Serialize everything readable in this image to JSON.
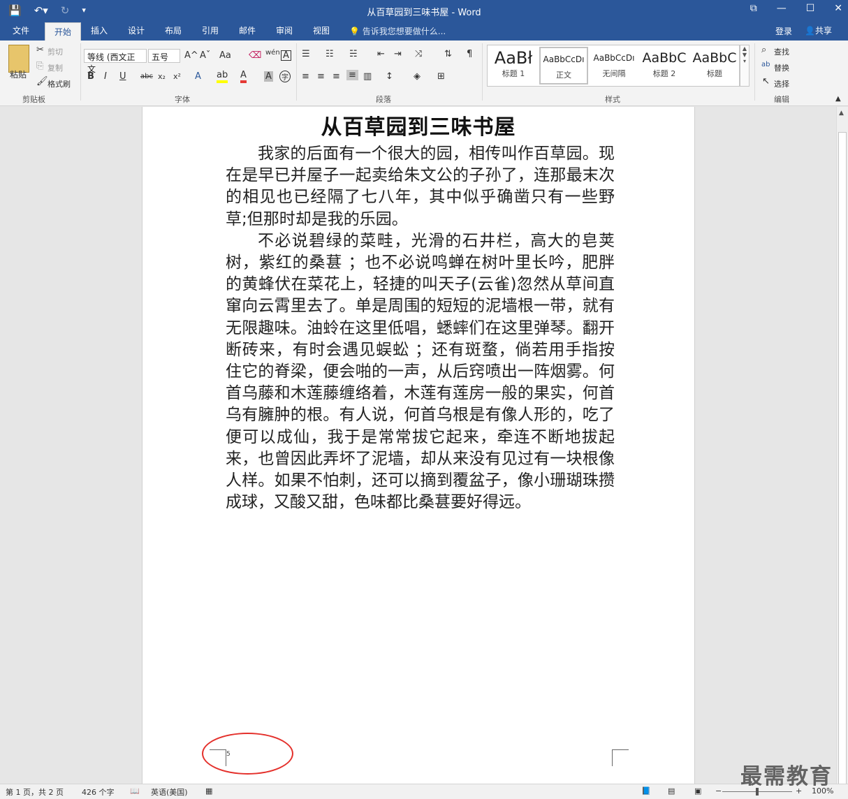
{
  "app": {
    "window_title": "从百草园到三味书屋 - Word"
  },
  "tabs": [
    {
      "label": "文件"
    },
    {
      "label": "开始"
    },
    {
      "label": "插入"
    },
    {
      "label": "设计"
    },
    {
      "label": "布局"
    },
    {
      "label": "引用"
    },
    {
      "label": "邮件"
    },
    {
      "label": "审阅"
    },
    {
      "label": "视图"
    }
  ],
  "tell_me": "告诉我您想要做什么...",
  "account": {
    "login": "登录",
    "share": "共享"
  },
  "clipboard": {
    "paste": "粘贴",
    "cut": "剪切",
    "copy": "复制",
    "format_painter": "格式刷",
    "group": "剪贴板"
  },
  "font": {
    "name": "等线 (西文正文",
    "size": "五号",
    "group": "字体",
    "bold": "B",
    "italic": "I",
    "underline": "U",
    "strike": "abc",
    "subscript": "x₂",
    "superscript": "x²",
    "grow": "A^",
    "shrink": "Aˇ",
    "change_case": "Aa",
    "phonetic": "wén",
    "border": "A",
    "effects": "A",
    "color": "A",
    "shading": "A",
    "enclose": "字"
  },
  "paragraph": {
    "group": "段落"
  },
  "styles": {
    "group": "样式",
    "items": [
      {
        "preview": "AaBł",
        "name": "标题 1"
      },
      {
        "preview": "AaBbCcDı",
        "name": "正文"
      },
      {
        "preview": "AaBbCcDı",
        "name": "无间隔"
      },
      {
        "preview": "AaBbC",
        "name": "标题 2"
      },
      {
        "preview": "AaBbC",
        "name": "标题"
      }
    ]
  },
  "editing": {
    "find": "查找",
    "replace": "替换",
    "select": "选择",
    "group": "编辑"
  },
  "document": {
    "title": "从百草园到三味书屋",
    "paragraphs": [
      "我家的后面有一个很大的园，相传叫作百草园。现在是早已并屋子一起卖给朱文公的子孙了，连那最末次的相见也已经隔了七八年，其中似乎确凿只有一些野草;但那时却是我的乐园。",
      "不必说碧绿的菜畦，光滑的石井栏，高大的皂荚树，紫红的桑葚 ；也不必说鸣蝉在树叶里长吟，肥胖的黄蜂伏在菜花上，轻捷的叫天子(云雀)忽然从草间直窜向云霄里去了。单是周围的短短的泥墙根一带，就有无限趣味。油蛉在这里低唱，蟋蟀们在这里弹琴。翻开断砖来，有时会遇见蜈蚣 ；还有斑蝥，倘若用手指按住它的脊梁，便会啪的一声，从后窍喷出一阵烟雾。何首乌藤和木莲藤缠络着，木莲有莲房一般的果实，何首乌有臃肿的根。有人说，何首乌根是有像人形的，吃了便可以成仙，我于是常常拔它起来，牵连不断地拔起来，也曾因此弄坏了泥墙，却从来没有见过有一块根像人样。如果不怕刺，还可以摘到覆盆子，像小珊瑚珠攒成球，又酸又甜，色味都比桑葚要好得远。"
    ],
    "page_number": "5"
  },
  "status": {
    "page": "第 1 页，共 2 页",
    "words": "426 个字",
    "language": "英语(美国)",
    "zoom": "100%",
    "zoom_fraction": 0.5
  },
  "watermark": "最需教育",
  "colors": {
    "accent": "#2b579a",
    "annotation": "#e4302b"
  }
}
